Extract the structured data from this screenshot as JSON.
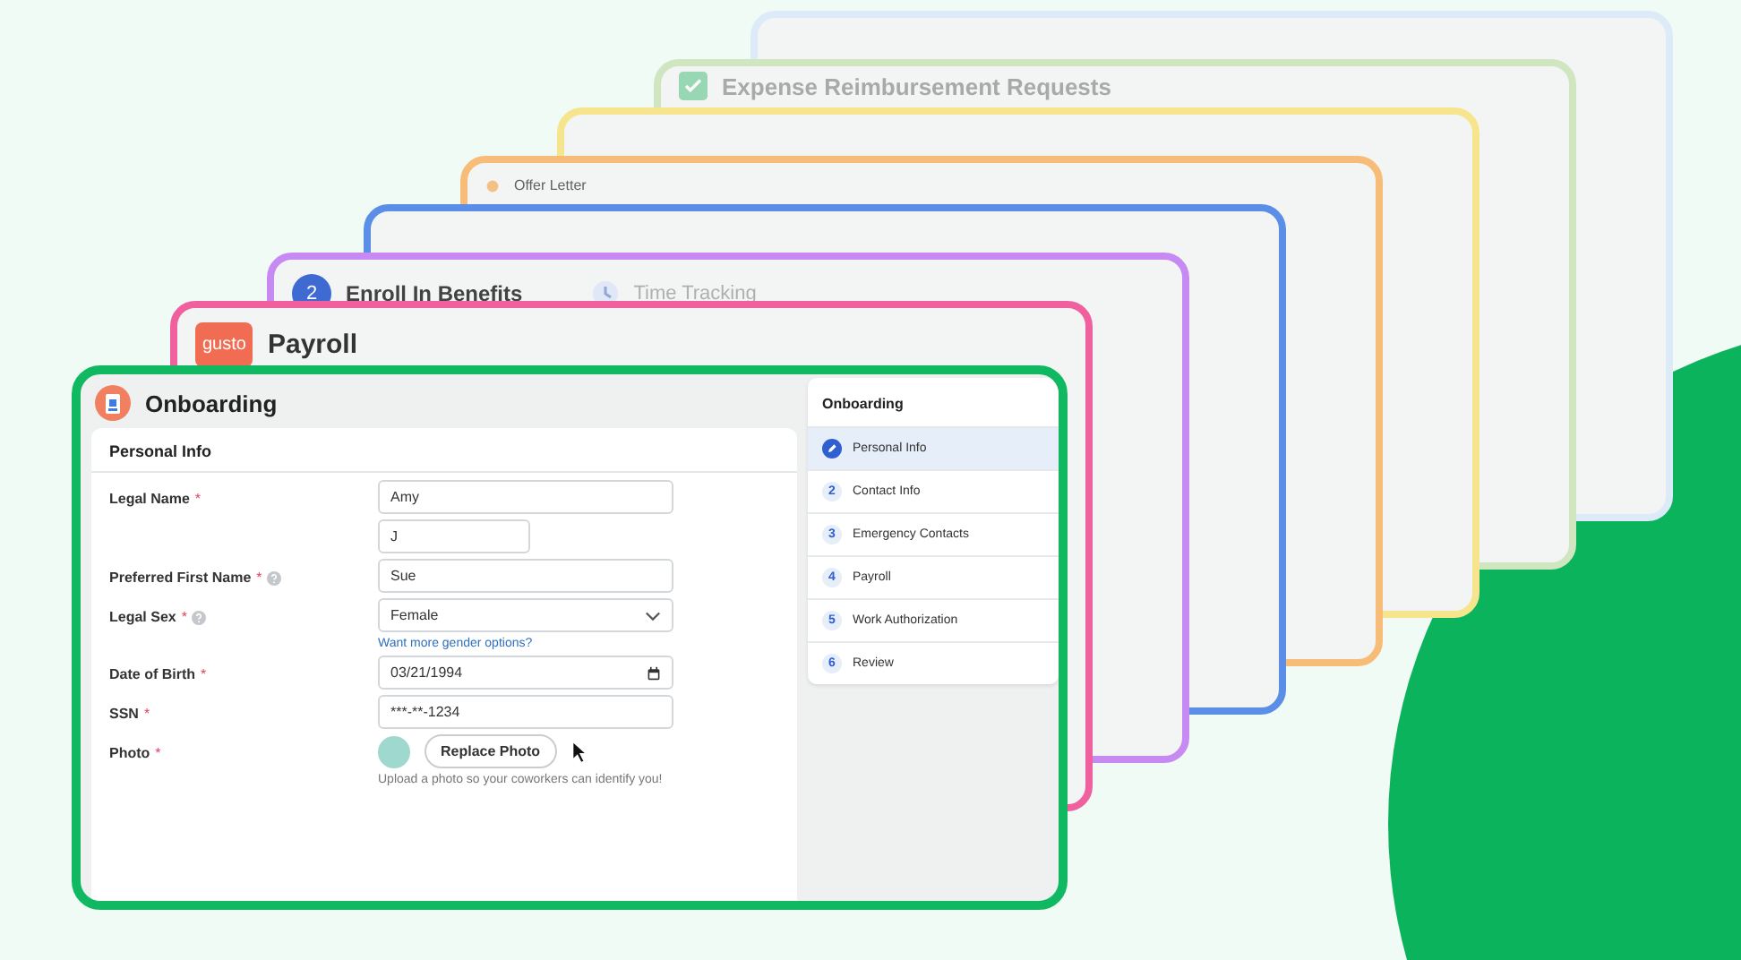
{
  "back_cards": [
    {
      "kind": "plain"
    },
    {
      "kind": "check",
      "title": "Expense Reimbursement Requests"
    },
    {
      "kind": "plain"
    },
    {
      "kind": "dot",
      "title": "Offer Letter"
    },
    {
      "kind": "plain"
    },
    {
      "kind": "number",
      "title": "Enroll In Benefits",
      "number": "2",
      "subtitle": "Time Tracking"
    },
    {
      "kind": "logo",
      "title": "Payroll",
      "logo_text": "gusto"
    }
  ],
  "onboarding": {
    "title": "Onboarding",
    "section": "Personal Info",
    "fields": [
      {
        "kind": "text",
        "label": "Legal Name",
        "required_mark": "*",
        "help": false,
        "inputs": [
          "Amy",
          "J"
        ]
      },
      {
        "kind": "text",
        "label": "Preferred First Name",
        "required_mark": "*",
        "help": true,
        "inputs": [
          "Sue"
        ]
      },
      {
        "kind": "select",
        "label": "Legal Sex",
        "required_mark": "*",
        "help": true,
        "value": "Female",
        "link": "Want more gender options?"
      },
      {
        "kind": "date",
        "label": "Date of Birth",
        "required_mark": "*",
        "help": false,
        "value": "03/21/1994"
      },
      {
        "kind": "text",
        "label": "SSN",
        "required_mark": "*",
        "help": false,
        "inputs": [
          "***-**-1234"
        ]
      },
      {
        "kind": "photo",
        "label": "Photo",
        "required_mark": "*",
        "help": false,
        "button": "Replace Photo",
        "hint": "Upload a photo so your coworkers can identify you!"
      }
    ]
  },
  "steps": {
    "title": "Onboarding",
    "items": [
      {
        "label": "Personal Info",
        "selected": true
      },
      {
        "number": "2",
        "label": "Contact Info",
        "selected": false
      },
      {
        "number": "3",
        "label": "Emergency Contacts",
        "selected": false
      },
      {
        "number": "4",
        "label": "Payroll",
        "selected": false
      },
      {
        "number": "5",
        "label": "Work Authorization",
        "selected": false
      },
      {
        "number": "6",
        "label": "Review",
        "selected": false
      }
    ]
  }
}
